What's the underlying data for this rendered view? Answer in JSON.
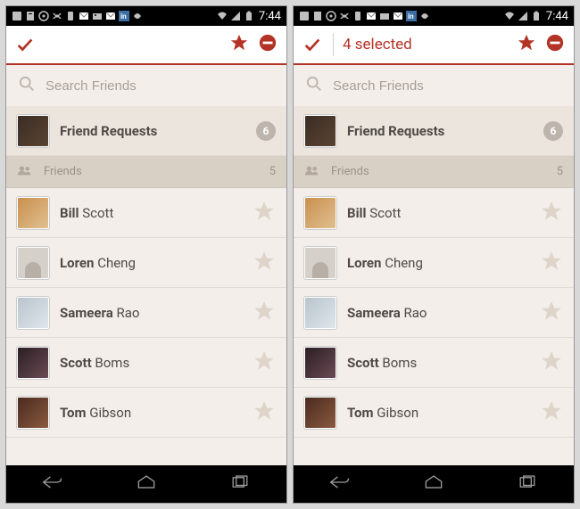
{
  "status": {
    "time": "7:44"
  },
  "header": {
    "selected_text": "4 selected"
  },
  "search": {
    "placeholder": "Search Friends"
  },
  "friend_requests": {
    "label": "Friend Requests",
    "count": "6"
  },
  "friends_section": {
    "label": "Friends",
    "count": "5"
  },
  "friends": [
    {
      "first": "Bill",
      "last": "Scott"
    },
    {
      "first": "Loren",
      "last": "Cheng"
    },
    {
      "first": "Sameera",
      "last": "Rao"
    },
    {
      "first": "Scott",
      "last": "Boms"
    },
    {
      "first": "Tom",
      "last": "Gibson"
    }
  ]
}
